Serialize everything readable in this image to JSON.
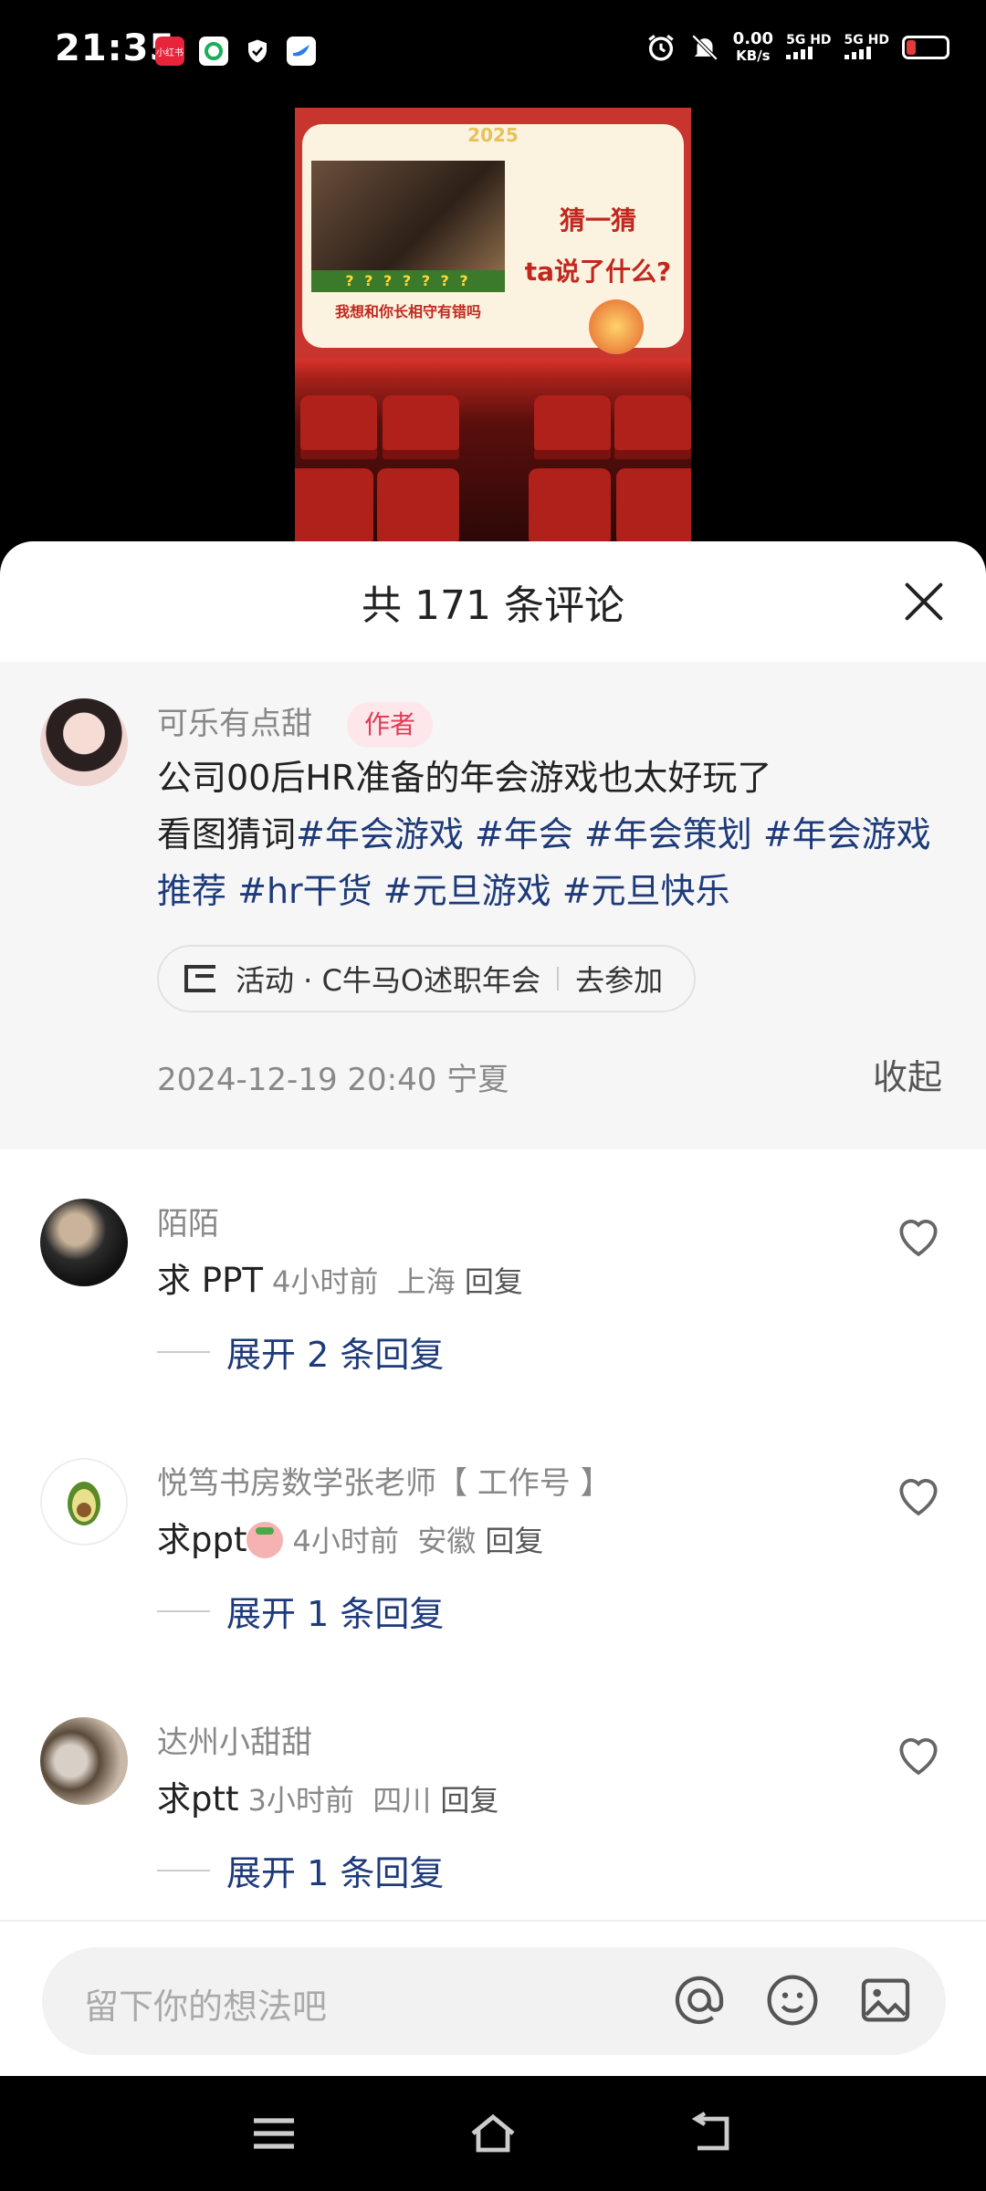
{
  "status_bar": {
    "time": "21:35",
    "net_speed": "0.00",
    "net_unit": "KB/s",
    "sim1": "5G HD",
    "sim2": "5G HD",
    "app_icons": [
      "xiaohongshu-icon",
      "browser-icon",
      "shield-icon",
      "bird-icon"
    ],
    "battery_color": "#e23b3b"
  },
  "video": {
    "year": "2025",
    "question_marks": "? ? ? ? ? ? ?",
    "caption": "我想和你长相守有错吗",
    "guess_line1": "猜一猜",
    "guess_line2": "ta说了什么?"
  },
  "sheet": {
    "title": "共 171 条评论"
  },
  "author_comment": {
    "name": "可乐有点甜",
    "tag": "作者",
    "text_line1": "公司00后HR准备的年会游戏也太好玩了",
    "text_prefix": "看图猜词",
    "hashtags": [
      "#年会游戏",
      "#年会",
      "#年会策划",
      "#年会游戏推荐",
      "#hr干货",
      "#元旦游戏",
      "#元旦快乐"
    ],
    "activity_label": "活动 · C牛马O述职年会",
    "activity_action": "去参加",
    "date": "2024-12-19 20:40",
    "location": "宁夏",
    "collapse": "收起"
  },
  "comments": [
    {
      "name": "陌陌",
      "text": "求 PPT",
      "time": "4小时前",
      "location": "上海",
      "reply": "回复",
      "expand": "展开 2 条回复"
    },
    {
      "name": "悦笃书房数学张老师【 工作号 】",
      "text": "求ppt",
      "emoji": "pig-face-emoji",
      "time": "4小时前",
      "location": "安徽",
      "reply": "回复",
      "expand": "展开 1 条回复"
    },
    {
      "name": "达州小甜甜",
      "text": "求ptt",
      "time": "3小时前",
      "location": "四川",
      "reply": "回复",
      "expand": "展开 1 条回复"
    }
  ],
  "input": {
    "placeholder": "留下你的想法吧"
  },
  "colors": {
    "hashtag": "#1d3a7a",
    "author_tag_bg": "#fde7ea",
    "author_tag_text": "#e33a55"
  }
}
